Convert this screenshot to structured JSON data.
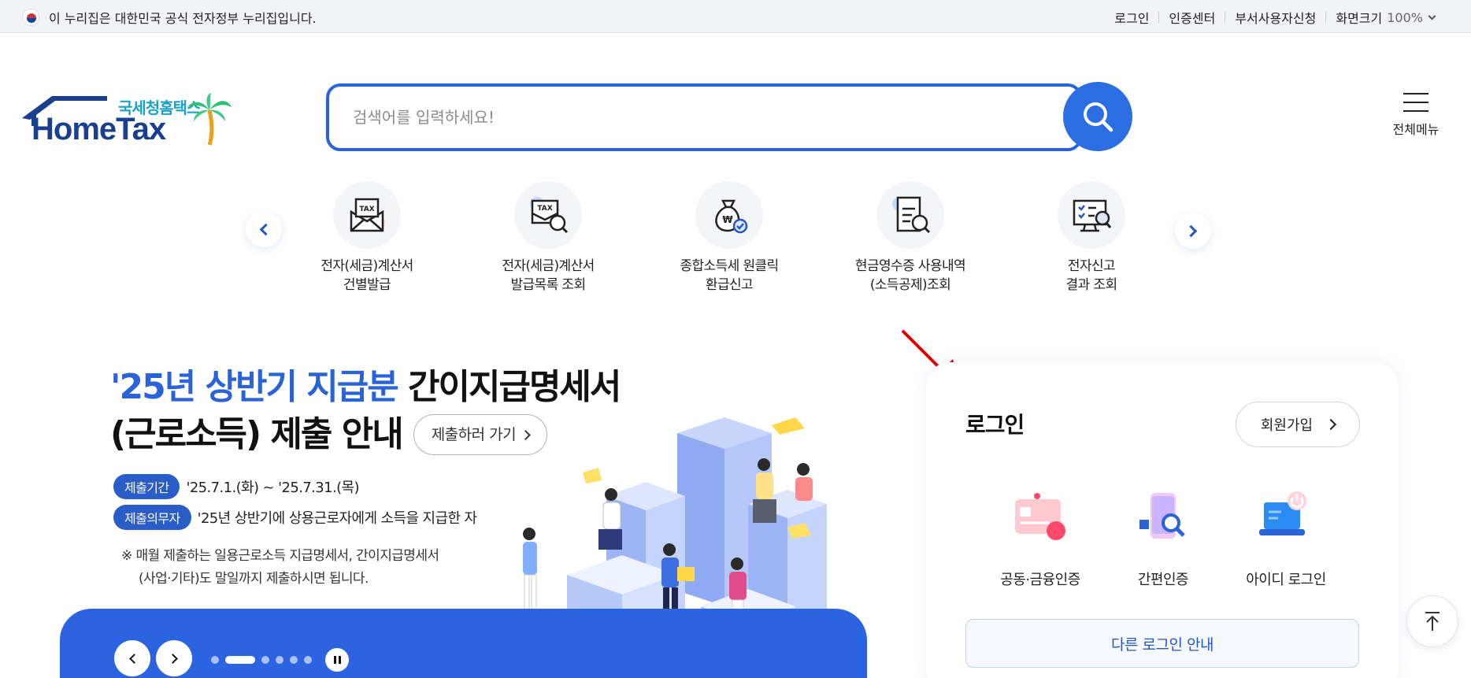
{
  "gov_bar": {
    "notice": "이 누리집은 대한민국 공식 전자정부 누리집입니다.",
    "links": [
      "로그인",
      "인증센터",
      "부서사용자신청"
    ],
    "zoom_label": "화면크기",
    "zoom_value": "100%"
  },
  "logo": {
    "kr": "국세청홈택스",
    "en": "HomeTax"
  },
  "search": {
    "placeholder": "검색어를 입력하세요!"
  },
  "menu": {
    "label": "전체메뉴"
  },
  "quick_menu": [
    {
      "line1": "전자(세금)계산서",
      "line2": "건별발급",
      "icon": "tax-invoice-envelope-icon"
    },
    {
      "line1": "전자(세금)계산서",
      "line2": "발급목록 조회",
      "icon": "tax-invoice-search-icon"
    },
    {
      "line1": "종합소득세 원클릭",
      "line2": "환급신고",
      "icon": "money-bag-icon"
    },
    {
      "line1": "현금영수증 사용내역",
      "line2": "(소득공제)조회",
      "icon": "receipt-search-icon"
    },
    {
      "line1": "전자신고",
      "line2": "결과 조회",
      "icon": "monitor-check-icon"
    }
  ],
  "banner": {
    "title_blue": "'25년 상반기 지급분",
    "title_black1": "간이지급명세서",
    "title_line2": "(근로소득) 제출 안내",
    "cta": "제출하러 가기",
    "period_pill": "제출기간",
    "period_text": "'25.7.1.(화) ~ '25.7.31.(목)",
    "duty_pill": "제출의무자",
    "duty_text": "'25년 상반기에 상용근로자에게 소득을 지급한 자",
    "note_line1": "※ 매월 제출하는 일용근로소득 지급명세서, 간이지급명세서",
    "note_line2": "(사업·기타)도 말일까지 제출하시면 됩니다."
  },
  "carousel": {
    "slide_count": 6,
    "active_index": 1
  },
  "login": {
    "title": "로그인",
    "join": "회원가입",
    "options": [
      "공동·금융인증",
      "간편인증",
      "아이디 로그인"
    ],
    "other": "다른 로그인 안내"
  },
  "colors": {
    "primary": "#2a62d7",
    "navy": "#1b3f8f",
    "teal": "#1aa3c6",
    "annotation": "#e00000"
  }
}
